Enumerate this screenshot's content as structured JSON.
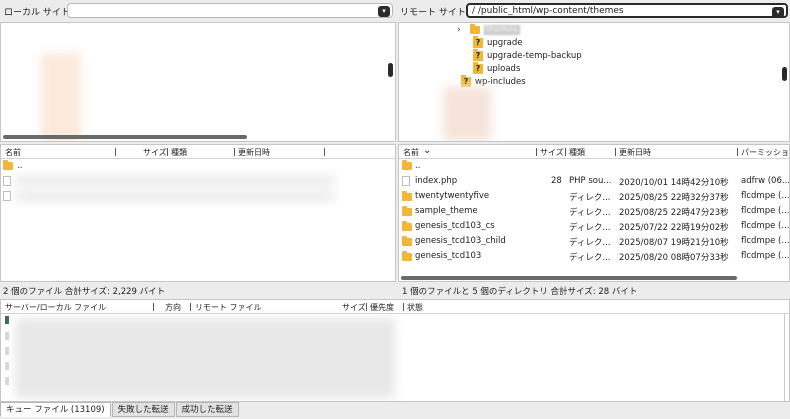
{
  "local_site": {
    "label": "ローカル サイト:",
    "path": ""
  },
  "remote_site": {
    "label": "リモート サイト:",
    "path": "/                    /public_html/wp-content/themes"
  },
  "remote_tree": {
    "items": [
      {
        "name": "themes",
        "icon": "folder-icon",
        "selected": true,
        "expander": "›"
      },
      {
        "name": "upgrade",
        "icon": "unknown-folder-icon"
      },
      {
        "name": "upgrade-temp-backup",
        "icon": "unknown-folder-icon"
      },
      {
        "name": "uploads",
        "icon": "unknown-folder-icon"
      },
      {
        "name": "wp-includes",
        "icon": "unknown-folder-icon"
      }
    ]
  },
  "local_list": {
    "headers": {
      "name": "名前",
      "size": "サイズ",
      "type": "種類",
      "modified": "更新日時"
    },
    "parent_row": "..",
    "status": "2 個のファイル 合計サイズ: 2,229 バイト"
  },
  "remote_list": {
    "headers": {
      "name": "名前",
      "sort_icon": "⌄",
      "size": "サイズ",
      "type": "種類",
      "modified": "更新日時",
      "permissions": "パーミッション"
    },
    "parent_row": "..",
    "rows": [
      {
        "name": "index.php",
        "size": "28",
        "type": "PHP sou...",
        "modified": "2020/10/01 14時42分10秒",
        "perm": "adfrw (06..."
      },
      {
        "name": "twentytwentyfive",
        "size": "",
        "type": "ディレク...",
        "modified": "2025/08/25 22時32分37秒",
        "perm": "flcdmpe (..."
      },
      {
        "name": "sample_theme",
        "size": "",
        "type": "ディレク...",
        "modified": "2025/08/25 22時47分23秒",
        "perm": "flcdmpe (..."
      },
      {
        "name": "genesis_tcd103_cs",
        "size": "",
        "type": "ディレク...",
        "modified": "2025/07/22 22時19分02秒",
        "perm": "flcdmpe (..."
      },
      {
        "name": "genesis_tcd103_child",
        "size": "",
        "type": "ディレク...",
        "modified": "2025/08/07 19時21分10秒",
        "perm": "flcdmpe (..."
      },
      {
        "name": "genesis_tcd103",
        "size": "",
        "type": "ディレク...",
        "modified": "2025/08/20 08時07分33秒",
        "perm": "flcdmpe (..."
      }
    ],
    "status": "1 個のファイルと 5 個のディレクトリ 合計サイズ: 28 バイト"
  },
  "queue": {
    "headers": {
      "server_local": "サーバー/ローカル ファイル",
      "direction": "方向",
      "remote": "リモート ファイル",
      "size": "サイズ",
      "priority": "優先度",
      "status": "状態"
    },
    "tabs": [
      {
        "label": "キュー ファイル (13109)",
        "active": true
      },
      {
        "label": "失敗した転送",
        "active": false
      },
      {
        "label": "成功した転送",
        "active": false
      }
    ]
  },
  "colors": {
    "folder": "#f2b73a",
    "scrollbar": "#2a2a2a",
    "pane_border": "#c6c6c6"
  }
}
